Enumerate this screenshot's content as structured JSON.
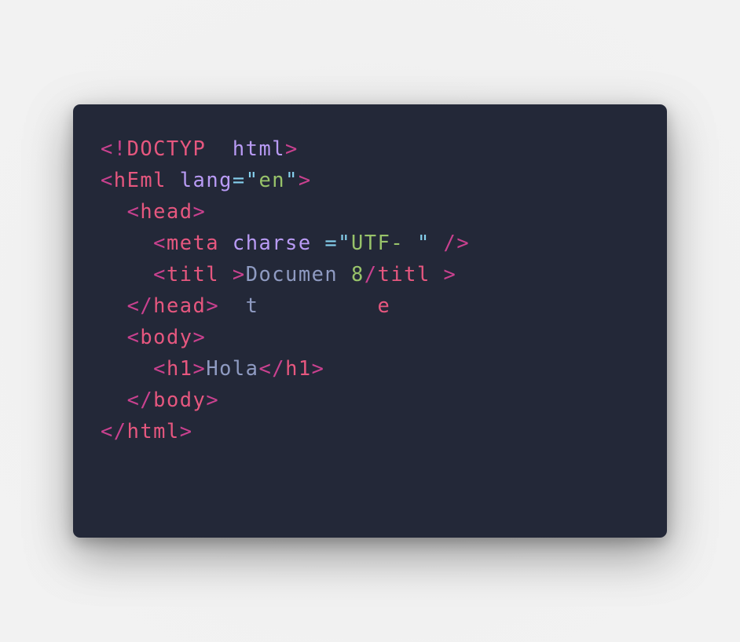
{
  "colors": {
    "background": "#f1f1f1",
    "editor_background": "#232838",
    "punctuation": "#c9418f",
    "tag": "#e6577f",
    "attribute": "#b99bf5",
    "operator": "#86d1ee",
    "string": "#98c36a",
    "text": "#8f9bc2"
  },
  "code_lines": [
    [
      {
        "t": "<!",
        "k": "punct"
      },
      {
        "t": "DOCTYP  ",
        "k": "tag"
      },
      {
        "t": "html",
        "k": "attr"
      },
      {
        "t": ">",
        "k": "punct"
      }
    ],
    [
      {
        "t": "<",
        "k": "punct"
      },
      {
        "t": "hEml",
        "k": "tag"
      },
      {
        "t": " ",
        "k": "text"
      },
      {
        "t": "lang",
        "k": "attr"
      },
      {
        "t": "=",
        "k": "op"
      },
      {
        "t": "\"",
        "k": "op"
      },
      {
        "t": "en",
        "k": "str"
      },
      {
        "t": "\"",
        "k": "op"
      },
      {
        "t": ">",
        "k": "punct"
      }
    ],
    [
      {
        "t": "  ",
        "k": "text"
      },
      {
        "t": "<",
        "k": "punct"
      },
      {
        "t": "head",
        "k": "tag"
      },
      {
        "t": ">",
        "k": "punct"
      }
    ],
    [
      {
        "t": "    ",
        "k": "text"
      },
      {
        "t": "<",
        "k": "punct"
      },
      {
        "t": "meta",
        "k": "tag"
      },
      {
        "t": " ",
        "k": "text"
      },
      {
        "t": "charse",
        "k": "attr"
      },
      {
        "t": " =",
        "k": "op"
      },
      {
        "t": "\"",
        "k": "op"
      },
      {
        "t": "UTF- ",
        "k": "str"
      },
      {
        "t": "\"",
        "k": "op"
      },
      {
        "t": " ",
        "k": "text"
      },
      {
        "t": "/>",
        "k": "punct"
      }
    ],
    [
      {
        "t": "    ",
        "k": "text"
      },
      {
        "t": "<",
        "k": "punct"
      },
      {
        "t": "titl",
        "k": "tag"
      },
      {
        "t": " ",
        "k": "text"
      },
      {
        "t": ">",
        "k": "punct"
      },
      {
        "t": "Documen ",
        "k": "text"
      },
      {
        "t": "8",
        "k": "str"
      },
      {
        "t": "/",
        "k": "punct"
      },
      {
        "t": "titl",
        "k": "tag"
      },
      {
        "t": " ",
        "k": "text"
      },
      {
        "t": ">",
        "k": "punct"
      }
    ],
    [
      {
        "t": "  ",
        "k": "text"
      },
      {
        "t": "</",
        "k": "punct"
      },
      {
        "t": "head",
        "k": "tag"
      },
      {
        "t": ">",
        "k": "punct"
      },
      {
        "t": "  t         ",
        "k": "text"
      },
      {
        "t": "e",
        "k": "tag"
      }
    ],
    [
      {
        "t": "  ",
        "k": "text"
      },
      {
        "t": "<",
        "k": "punct"
      },
      {
        "t": "body",
        "k": "tag"
      },
      {
        "t": ">",
        "k": "punct"
      }
    ],
    [
      {
        "t": "    ",
        "k": "text"
      },
      {
        "t": "<",
        "k": "punct"
      },
      {
        "t": "h1",
        "k": "tag"
      },
      {
        "t": ">",
        "k": "punct"
      },
      {
        "t": "Hola",
        "k": "text"
      },
      {
        "t": "</",
        "k": "punct"
      },
      {
        "t": "h1",
        "k": "tag"
      },
      {
        "t": ">",
        "k": "punct"
      }
    ],
    [
      {
        "t": "  ",
        "k": "text"
      },
      {
        "t": "</",
        "k": "punct"
      },
      {
        "t": "body",
        "k": "tag"
      },
      {
        "t": ">",
        "k": "punct"
      }
    ],
    [
      {
        "t": "</",
        "k": "punct"
      },
      {
        "t": "html",
        "k": "tag"
      },
      {
        "t": ">",
        "k": "punct"
      }
    ]
  ]
}
